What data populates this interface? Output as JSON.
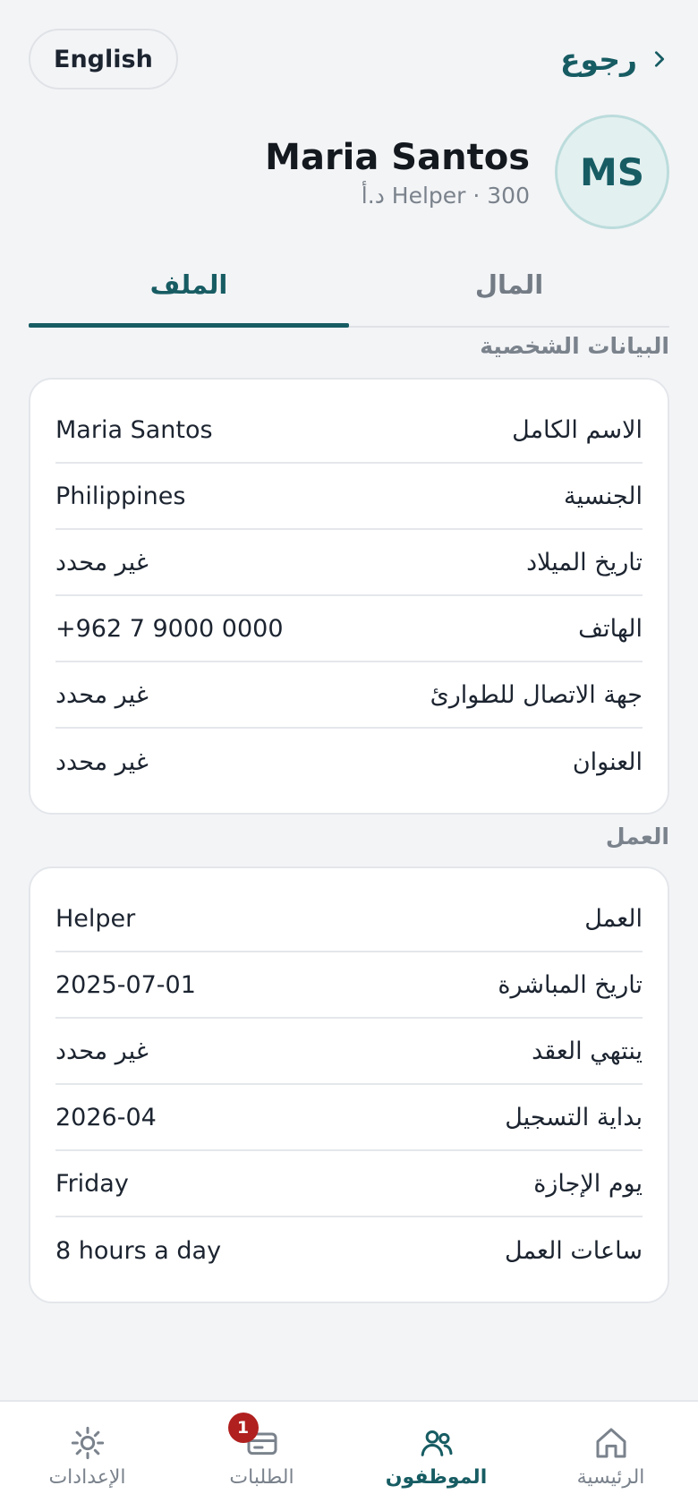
{
  "header": {
    "language_label": "English",
    "back_label": "رجوع"
  },
  "profile": {
    "initials": "MS",
    "name": "Maria Santos",
    "subtitle": "Helper · 300 د.أ"
  },
  "tabs": [
    {
      "label": "المال",
      "active": false
    },
    {
      "label": "الملف",
      "active": true
    }
  ],
  "personal": {
    "title": "البيانات الشخصية",
    "rows": [
      {
        "label": "الاسم الكامل",
        "value": "Maria Santos"
      },
      {
        "label": "الجنسية",
        "value": "Philippines"
      },
      {
        "label": "تاريخ الميلاد",
        "value": "غير محدد"
      },
      {
        "label": "الهاتف",
        "value": "+962 7 9000 0000"
      },
      {
        "label": "جهة الاتصال للطوارئ",
        "value": "غير محدد"
      },
      {
        "label": "العنوان",
        "value": "غير محدد"
      }
    ]
  },
  "work": {
    "title": "العمل",
    "rows": [
      {
        "label": "العمل",
        "value": "Helper"
      },
      {
        "label": "تاريخ المباشرة",
        "value": "2025-07-01"
      },
      {
        "label": "ينتهي العقد",
        "value": "غير محدد"
      },
      {
        "label": "بداية التسجيل",
        "value": "2026-04"
      },
      {
        "label": "يوم الإجازة",
        "value": "Friday"
      },
      {
        "label": "ساعات العمل",
        "value": "8 hours a day"
      }
    ]
  },
  "nav": {
    "items": [
      {
        "label": "الرئيسية",
        "icon": "home-icon"
      },
      {
        "label": "الموظفون",
        "icon": "people-icon",
        "active": true
      },
      {
        "label": "الطلبات",
        "icon": "card-icon",
        "badge": "1"
      },
      {
        "label": "الإعدادات",
        "icon": "settings-icon"
      }
    ]
  },
  "colors": {
    "accent": "#175c63",
    "badge": "#b0201f",
    "background": "#f3f4f6"
  }
}
